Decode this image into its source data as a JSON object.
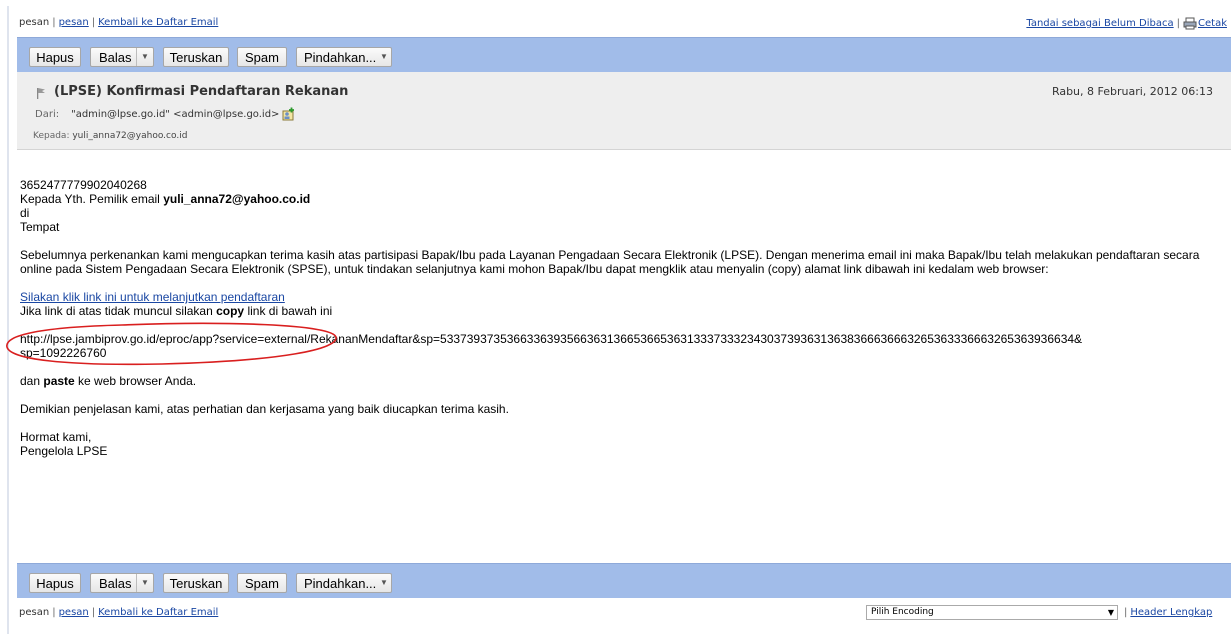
{
  "top_nav": {
    "item1": "pesan",
    "sep": "|",
    "item2": "pesan",
    "back_label": "Kembali ke Daftar Email"
  },
  "right_links": {
    "mark_unread": "Tandai sebagai Belum Dibaca",
    "sep": "|",
    "print": "Cetak"
  },
  "toolbar": {
    "delete": "Hapus",
    "reply": "Balas",
    "forward": "Teruskan",
    "spam": "Spam",
    "move": "Pindahkan..."
  },
  "email": {
    "subject": "(LPSE) Konfirmasi Pendaftaran Rekanan",
    "date": "Rabu, 8 Februari, 2012 06:13",
    "from_label": "Dari:",
    "from_value": "\"admin@lpse.go.id\" <admin@lpse.go.id>",
    "to_label": "Kepada:",
    "to_value": "yuli_anna72@yahoo.co.id"
  },
  "body": {
    "number": "3652477779902040268",
    "greeting_prefix": "Kepada Yth. Pemilik email ",
    "greeting_email": "yuli_anna72@yahoo.co.id",
    "di": "di",
    "tempat": "Tempat",
    "paragraph": "Sebelumnya perkenankan kami mengucapkan terima kasih atas partisipasi Bapak/Ibu pada Layanan Pengadaan Secara Elektronik (LPSE). Dengan menerima email ini maka Bapak/Ibu telah melakukan pendaftaran secara online pada Sistem Pengadaan Secara Elektronik (SPSE), untuk tindakan selanjutnya kami mohon Bapak/Ibu dapat mengklik atau menyalin (copy) alamat link dibawah ini kedalam web browser:",
    "link_text": "Silakan klik link ini untuk melanjutkan pendaftaran",
    "fallback_prefix": "Jika link di atas tidak muncul silakan ",
    "fallback_bold": "copy",
    "fallback_suffix": " link di bawah ini",
    "url_line1": "http://lpse.jambiprov.go.id/eproc/app?service=external/RekananMendaftar&sp=53373937353663363935663631366536653631333733323430373936313638366636663265363336663265363936634&",
    "url_line2": "sp=1092226760",
    "paste_prefix": "dan ",
    "paste_bold": "paste",
    "paste_suffix": " ke web browser Anda.",
    "closing": "Demikian penjelasan kami, atas perhatian dan kerjasama yang baik diucapkan terima kasih.",
    "regards": "Hormat kami,",
    "signature": "Pengelola LPSE"
  },
  "bottom_nav": {
    "item1": "pesan",
    "sep": "|",
    "item2": "pesan",
    "back_label": "Kembali ke Daftar Email"
  },
  "encoding": {
    "selected": "Pilih Encoding",
    "sep": "|",
    "header_full": "Header Lengkap"
  },
  "colors": {
    "toolbar_bg": "#a1bce9",
    "header_bg": "#eeeeee",
    "link": "#1a47a3",
    "annotation": "#d91f1f"
  },
  "icons": {
    "flag": "flag-icon",
    "print": "printer-icon",
    "add_contact": "add-contact-icon",
    "dropdown": "chevron-down-icon"
  }
}
